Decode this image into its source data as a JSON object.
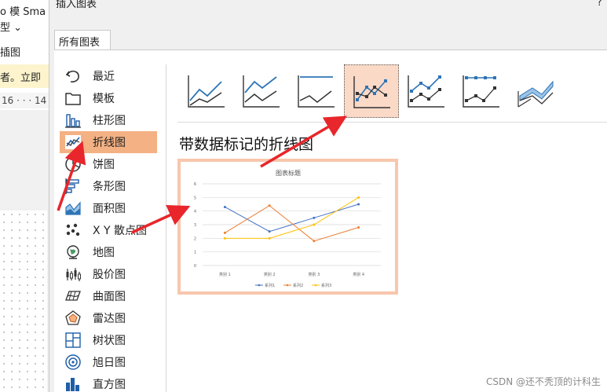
{
  "background_app": {
    "title_fragment": "o 模  Sma",
    "line2_fragment": "型 ⌄",
    "section_label": "插图",
    "notify_fragment": "者。立即",
    "ruler_fragment": "16 · · · 14"
  },
  "dialog": {
    "title": "插入图表",
    "help": "?",
    "tab_label": "所有图表"
  },
  "categories": [
    {
      "label": "最近",
      "icon": "recent-icon"
    },
    {
      "label": "模板",
      "icon": "template-icon"
    },
    {
      "label": "柱形图",
      "icon": "column-chart-icon"
    },
    {
      "label": "折线图",
      "icon": "line-chart-icon",
      "selected": true
    },
    {
      "label": "饼图",
      "icon": "pie-chart-icon"
    },
    {
      "label": "条形图",
      "icon": "bar-chart-icon"
    },
    {
      "label": "面积图",
      "icon": "area-chart-icon"
    },
    {
      "label": "X Y 散点图",
      "icon": "scatter-chart-icon"
    },
    {
      "label": "地图",
      "icon": "map-chart-icon"
    },
    {
      "label": "股价图",
      "icon": "stock-chart-icon"
    },
    {
      "label": "曲面图",
      "icon": "surface-chart-icon"
    },
    {
      "label": "雷达图",
      "icon": "radar-chart-icon"
    },
    {
      "label": "树状图",
      "icon": "treemap-chart-icon"
    },
    {
      "label": "旭日图",
      "icon": "sunburst-chart-icon"
    },
    {
      "label": "直方图",
      "icon": "histogram-chart-icon"
    }
  ],
  "subtypes": [
    {
      "name": "line",
      "selected": false
    },
    {
      "name": "stacked-line",
      "selected": false
    },
    {
      "name": "percent-stacked-line",
      "selected": false
    },
    {
      "name": "line-with-markers",
      "selected": true
    },
    {
      "name": "stacked-line-with-markers",
      "selected": false
    },
    {
      "name": "percent-stacked-line-with-markers",
      "selected": false
    },
    {
      "name": "3d-line",
      "selected": false
    }
  ],
  "selected_subtype_title": "带数据标记的折线图",
  "colors": {
    "accent_selected": "#f4b183",
    "series1": "#4472c4",
    "series2": "#ed7d31",
    "series3": "#ffc000",
    "arrow": "#e8262b"
  },
  "chart_data": {
    "type": "line",
    "title": "图表标题",
    "categories": [
      "类别 1",
      "类别 2",
      "类别 3",
      "类别 4"
    ],
    "series": [
      {
        "name": "系列1",
        "values": [
          4.3,
          2.5,
          3.5,
          4.5
        ]
      },
      {
        "name": "系列2",
        "values": [
          2.4,
          4.4,
          1.8,
          2.8
        ]
      },
      {
        "name": "系列3",
        "values": [
          2.0,
          2.0,
          3.0,
          5.0
        ]
      }
    ],
    "yticks": [
      "0",
      "1",
      "2",
      "3",
      "4",
      "5",
      "6"
    ],
    "ylim": [
      0,
      6
    ],
    "grid": true,
    "legend": "bottom"
  },
  "watermark": "CSDN @还不秃顶的计科生"
}
